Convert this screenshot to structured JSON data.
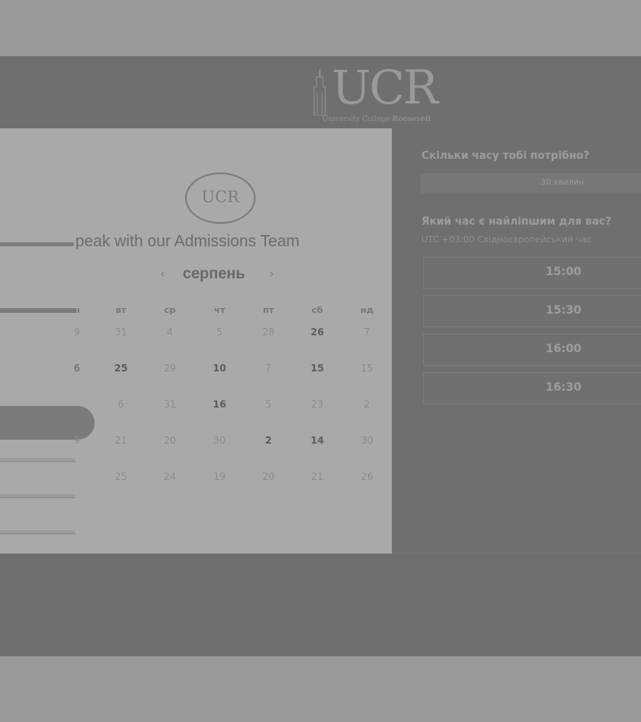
{
  "header": {
    "logo_text": "UCR",
    "logo_subtitle": "University College",
    "logo_subtitle_emph": "Roosevelt"
  },
  "calendar": {
    "circle_logo_text": "UCR",
    "title": "peak with our Admissions Team",
    "month": "серпень",
    "prev_icon": "‹",
    "next_icon": "›",
    "weekdays": [
      "вт",
      "ср",
      "чт",
      "пт",
      "сб",
      "нд"
    ],
    "first_col_fragment": "н",
    "rows": [
      {
        "first": "9",
        "days": [
          "31",
          "4",
          "5",
          "28",
          "26",
          "7"
        ]
      },
      {
        "first": "6",
        "days": [
          "25",
          "29",
          "10",
          "7",
          "15",
          "15"
        ]
      },
      {
        "first": "",
        "days": [
          "6",
          "31",
          "16",
          "5",
          "23",
          "2"
        ]
      },
      {
        "first": "9",
        "days": [
          "21",
          "20",
          "30",
          "2",
          "14",
          "30"
        ]
      },
      {
        "first": "",
        "days": [
          "25",
          "24",
          "19",
          "20",
          "21",
          "26"
        ]
      }
    ]
  },
  "booking": {
    "duration_question": "Скільки часу тобі потрібно?",
    "duration_value": "30 хвилин",
    "time_question": "Який час є найліпшим для вас?",
    "timezone": "UTC +03:00 Східноєвропейський час",
    "slots": [
      "15:00",
      "15:30",
      "16:00",
      "16:30"
    ]
  }
}
